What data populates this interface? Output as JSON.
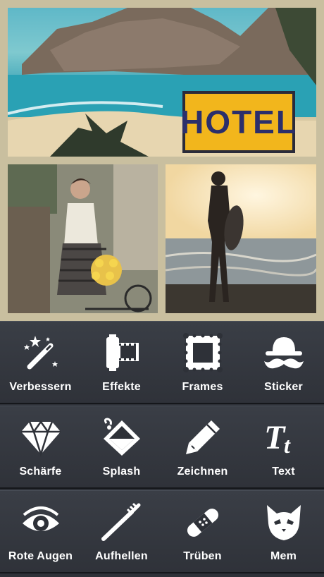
{
  "collage": {
    "photos": [
      {
        "name": "coastal-hotel-photo",
        "sign_text": "HOTEL"
      },
      {
        "name": "vintage-woman-bicycle-photo"
      },
      {
        "name": "surfer-sunset-beach-photo"
      }
    ]
  },
  "toolbar": {
    "rows": [
      [
        {
          "label": "Verbessern",
          "icon": "magic-wand-icon"
        },
        {
          "label": "Effekte",
          "icon": "film-roll-icon"
        },
        {
          "label": "Frames",
          "icon": "frame-icon"
        },
        {
          "label": "Sticker",
          "icon": "hat-mustache-icon"
        }
      ],
      [
        {
          "label": "Schärfe",
          "icon": "diamond-icon"
        },
        {
          "label": "Splash",
          "icon": "paint-bucket-icon"
        },
        {
          "label": "Zeichnen",
          "icon": "pencil-icon"
        },
        {
          "label": "Text",
          "icon": "text-tt-icon"
        }
      ],
      [
        {
          "label": "Rote Augen",
          "icon": "eye-icon"
        },
        {
          "label": "Aufhellen",
          "icon": "toothbrush-icon"
        },
        {
          "label": "Trüben",
          "icon": "bandage-icon"
        },
        {
          "label": "Mem",
          "icon": "cat-face-icon"
        }
      ]
    ]
  },
  "colors": {
    "collage_border": "#c9bf9f",
    "toolbar_bg": "#2e3138",
    "label_text": "#ffffff",
    "icon_fill": "#ffffff"
  }
}
